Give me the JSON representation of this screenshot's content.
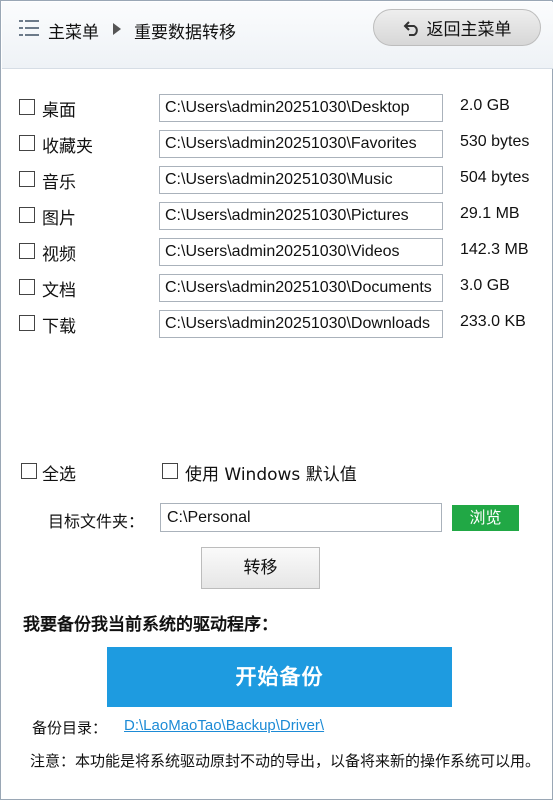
{
  "header": {
    "main_menu": "主菜单",
    "page_title": "重要数据转移",
    "back_button": "返回主菜单"
  },
  "folders": [
    {
      "label": "桌面",
      "path": "C:\\Users\\admin20251030\\Desktop",
      "size": "2.0 GB"
    },
    {
      "label": "收藏夹",
      "path": "C:\\Users\\admin20251030\\Favorites",
      "size": "530 bytes"
    },
    {
      "label": "音乐",
      "path": "C:\\Users\\admin20251030\\Music",
      "size": "504 bytes"
    },
    {
      "label": "图片",
      "path": "C:\\Users\\admin20251030\\Pictures",
      "size": "29.1 MB"
    },
    {
      "label": "视频",
      "path": "C:\\Users\\admin20251030\\Videos",
      "size": "142.3 MB"
    },
    {
      "label": "文档",
      "path": "C:\\Users\\admin20251030\\Documents",
      "size": "3.0 GB"
    },
    {
      "label": "下载",
      "path": "C:\\Users\\admin20251030\\Downloads",
      "size": "233.0 KB"
    }
  ],
  "options": {
    "select_all": "全选",
    "use_windows_default": "使用 Windows 默认值"
  },
  "target": {
    "label": "目标文件夹：",
    "value": "C:\\Personal",
    "browse": "浏览"
  },
  "transfer_button": "转移",
  "backup": {
    "heading": "我要备份我当前系统的驱动程序：",
    "start_button": "开始备份",
    "dir_label": "备份目录：",
    "dir_link": "D:\\LaoMaoTao\\Backup\\Driver\\",
    "notice": "注意：本功能是将系统驱动原封不动的导出，以备将来新的操作系统可以用。"
  },
  "colors": {
    "browse_green": "#21a845",
    "backup_blue": "#1e9be0",
    "link_blue": "#1d8bd6"
  },
  "icons": {
    "menu": "list-menu-icon",
    "breadcrumb": "triangle-right-icon",
    "back": "undo-arrow-icon"
  }
}
